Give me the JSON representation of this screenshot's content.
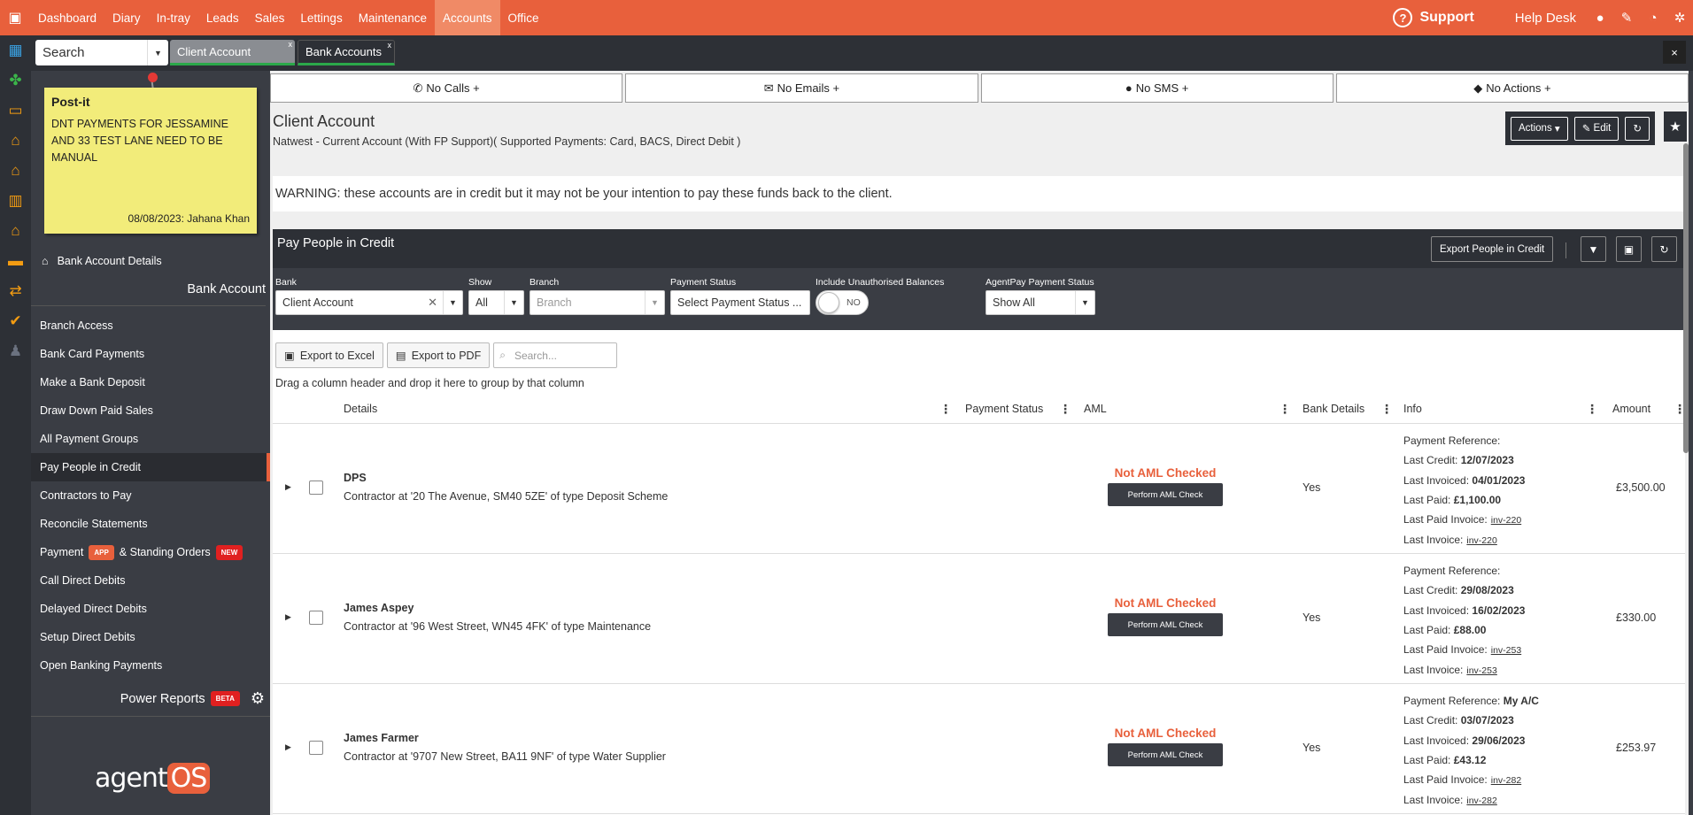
{
  "topnav": {
    "items": [
      {
        "label": "Dashboard"
      },
      {
        "label": "Diary"
      },
      {
        "label": "In-tray"
      },
      {
        "label": "Leads"
      },
      {
        "label": "Sales"
      },
      {
        "label": "Lettings"
      },
      {
        "label": "Maintenance"
      },
      {
        "label": "Accounts",
        "active": true
      },
      {
        "label": "Office"
      }
    ],
    "support_label": "Support",
    "helpdesk_label": "Help Desk",
    "brand_color": "#e8603c"
  },
  "subbar": {
    "search_label": "Search",
    "tabs": [
      {
        "label": "Client Account",
        "close": "x"
      },
      {
        "label": "Bank Accounts",
        "close": "x"
      }
    ],
    "close_all": "×"
  },
  "postit": {
    "title": "Post-it",
    "body": "DNT PAYMENTS FOR JESSAMINE AND 33 TEST LANE NEED TO BE MANUAL",
    "footer": "08/08/2023: Jahana Khan"
  },
  "sidebar": {
    "detail_link": "Bank Account Details",
    "header": "Bank Account",
    "items": [
      {
        "label": "Branch Access"
      },
      {
        "label": "Bank Card Payments"
      },
      {
        "label": "Make a Bank Deposit"
      },
      {
        "label": "Draw Down Paid Sales"
      },
      {
        "label": "All Payment Groups"
      },
      {
        "label": "Pay People in Credit",
        "active": true
      },
      {
        "label": "Contractors to Pay"
      },
      {
        "label": "Reconcile Statements"
      },
      {
        "label": "Payment",
        "badge": "APP",
        "label2": "& Standing Orders",
        "badge2": "NEW"
      },
      {
        "label": "Call Direct Debits"
      },
      {
        "label": "Delayed Direct Debits"
      },
      {
        "label": "Setup Direct Debits"
      },
      {
        "label": "Open Banking Payments"
      }
    ],
    "power_reports": "Power Reports",
    "power_badge": "BETA",
    "logo_part1": "agent",
    "logo_part2": "OS"
  },
  "actionbar": {
    "calls": "No Calls +",
    "emails": "No Emails +",
    "sms": "No SMS +",
    "actions": "No Actions +"
  },
  "page": {
    "title": "Client Account",
    "subtitle": "Natwest - Current Account (With FP Support)( Supported Payments: Card, BACS, Direct Debit )",
    "actions_btn": "Actions",
    "edit_btn": "Edit",
    "warning": "WARNING: these accounts are in credit but it may not be your intention to pay these funds back to the client."
  },
  "panel": {
    "title": "Pay People in Credit",
    "export_btn": "Export People in Credit"
  },
  "filters": {
    "bank": {
      "label": "Bank",
      "value": "Client Account"
    },
    "show": {
      "label": "Show",
      "value": "All"
    },
    "branch": {
      "label": "Branch",
      "placeholder": "Branch"
    },
    "payment_status": {
      "label": "Payment Status",
      "value": "Select Payment Status ..."
    },
    "unauthorised": {
      "label": "Include Unauthorised Balances",
      "value": "NO"
    },
    "agentpay": {
      "label": "AgentPay Payment Status",
      "value": "Show All"
    }
  },
  "tools": {
    "excel": "Export to Excel",
    "pdf": "Export to PDF",
    "search_placeholder": "Search...",
    "group_hint": "Drag a column header and drop it here to group by that column"
  },
  "grid": {
    "columns": [
      "Details",
      "Payment Status",
      "AML",
      "Bank Details",
      "Info",
      "Amount"
    ],
    "rows": [
      {
        "name": "DPS",
        "desc": "Contractor at '20 The Avenue, SM40 5ZE' of type Deposit Scheme",
        "aml_status": "Not AML Checked",
        "aml_button": "Perform AML Check",
        "bank_details": "Yes",
        "info": {
          "payment_ref_label": "Payment Reference:",
          "payment_ref": "",
          "last_credit_label": "Last Credit:",
          "last_credit": "12/07/2023",
          "last_invoiced_label": "Last Invoiced:",
          "last_invoiced": "04/01/2023",
          "last_paid_label": "Last Paid:",
          "last_paid": "£1,100.00",
          "last_paid_invoice_label": "Last Paid Invoice:",
          "last_paid_invoice": "inv-220",
          "last_invoice_label": "Last Invoice:",
          "last_invoice": "inv-220"
        },
        "amount": "£3,500.00"
      },
      {
        "name": "James Aspey",
        "desc": "Contractor at '96 West Street, WN45 4FK' of type Maintenance",
        "aml_status": "Not AML Checked",
        "aml_button": "Perform AML Check",
        "bank_details": "Yes",
        "info": {
          "payment_ref_label": "Payment Reference:",
          "payment_ref": "",
          "last_credit_label": "Last Credit:",
          "last_credit": "29/08/2023",
          "last_invoiced_label": "Last Invoiced:",
          "last_invoiced": "16/02/2023",
          "last_paid_label": "Last Paid:",
          "last_paid": "£88.00",
          "last_paid_invoice_label": "Last Paid Invoice:",
          "last_paid_invoice": "inv-253",
          "last_invoice_label": "Last Invoice:",
          "last_invoice": "inv-253"
        },
        "amount": "£330.00"
      },
      {
        "name": "James Farmer",
        "desc": "Contractor at '9707 New Street, BA11 9NF' of type Water Supplier",
        "aml_status": "Not AML Checked",
        "aml_button": "Perform AML Check",
        "bank_details": "Yes",
        "info": {
          "payment_ref_label": "Payment Reference:",
          "payment_ref": "My A/C",
          "last_credit_label": "Last Credit:",
          "last_credit": "03/07/2023",
          "last_invoiced_label": "Last Invoiced:",
          "last_invoiced": "29/06/2023",
          "last_paid_label": "Last Paid:",
          "last_paid": "£43.12",
          "last_paid_invoice_label": "Last Paid Invoice:",
          "last_paid_invoice": "inv-282",
          "last_invoice_label": "Last Invoice:",
          "last_invoice": "inv-282"
        },
        "amount": "£253.97"
      }
    ]
  }
}
